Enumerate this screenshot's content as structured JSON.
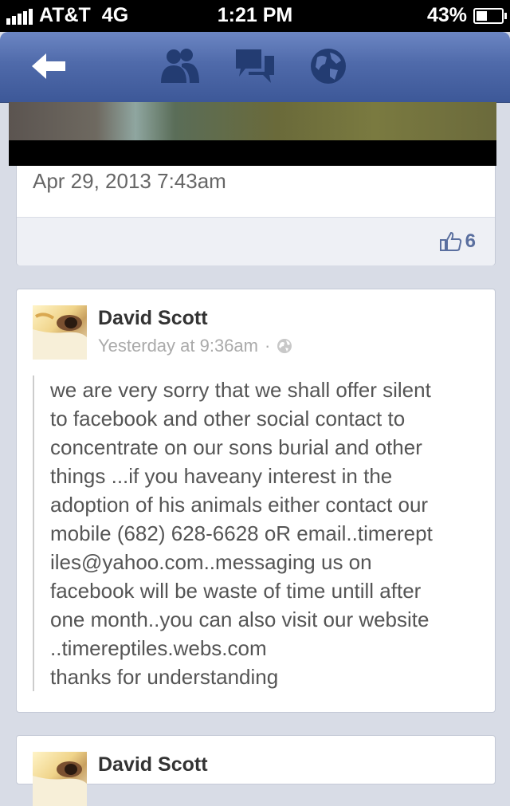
{
  "status_bar": {
    "carrier": "AT&T",
    "network": "4G",
    "time": "1:21 PM",
    "battery": "43%",
    "battery_level": 0.43
  },
  "nav": {
    "icons": [
      "back-arrow-icon",
      "friends-icon",
      "messages-icon",
      "globe-icon"
    ],
    "color": "#4f6aaa"
  },
  "post_prev": {
    "date": "Apr 29, 2013 7:43am",
    "likes": "6"
  },
  "post": {
    "author": "David Scott",
    "time": "Yesterday at 9:36am",
    "separator": "·",
    "lines": [
      "we are very sorry that we shall offer silent",
      "to facebook and other social contact to",
      "concentrate on our sons burial and other",
      "things ...if you haveany interest in the",
      "adoption of his animals either contact our",
      "mobile (682) 628-6628 oR email..timerept",
      "iles@yahoo.com..messaging us on",
      "facebook will be waste of time untill after",
      "one month..you can also visit our website",
      "..timereptiles.webs.com",
      "thanks for understanding"
    ]
  },
  "post_next": {
    "author": "David Scott"
  }
}
